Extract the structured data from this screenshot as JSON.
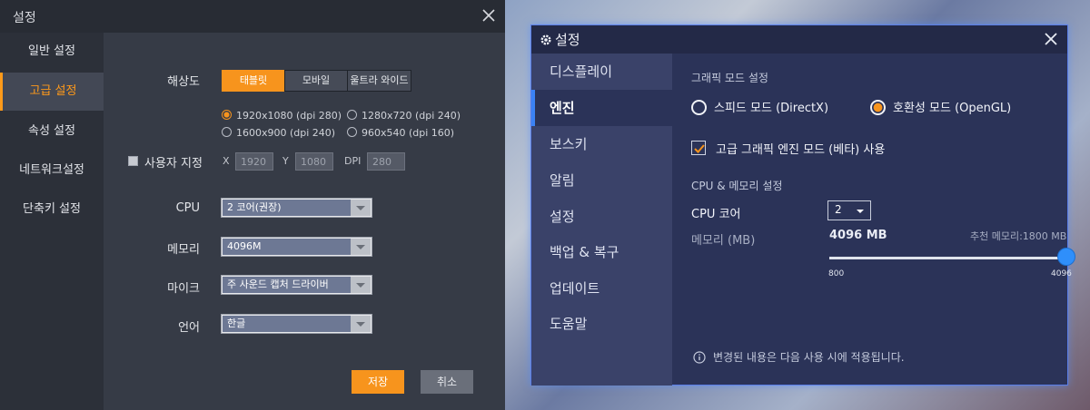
{
  "left": {
    "title": "설정",
    "sidebar": [
      "일반 설정",
      "고급 설정",
      "속성 설정",
      "네트워크설정",
      "단축키 설정"
    ],
    "active_index": 1,
    "resolution": {
      "label": "해상도",
      "tabs": [
        "태블릿",
        "모바일",
        "울트라 와이드"
      ],
      "active_tab": 0,
      "options": [
        "1920x1080 (dpi 280)",
        "1280x720 (dpi 240)",
        "1600x900 (dpi 240)",
        "960x540 (dpi 160)"
      ],
      "selected_option": 0
    },
    "custom": {
      "label": "사용자 지정",
      "x_label": "X",
      "x_value": "1920",
      "y_label": "Y",
      "y_value": "1080",
      "dpi_label": "DPI",
      "dpi_value": "280"
    },
    "cpu": {
      "label": "CPU",
      "value": "2 코어(권장)"
    },
    "memory": {
      "label": "메모리",
      "value": "4096M"
    },
    "mic": {
      "label": "마이크",
      "value": "주 사운드 캡처 드라이버"
    },
    "language": {
      "label": "언어",
      "value": "한글"
    },
    "save_label": "저장",
    "cancel_label": "취소",
    "accent_color": "#f7941d"
  },
  "right": {
    "title": "설정",
    "sidebar": [
      "디스플레이",
      "엔진",
      "보스키",
      "알림",
      "설정",
      "백업 & 복구",
      "업데이트",
      "도움말"
    ],
    "active_index": 1,
    "graphics": {
      "section": "그래픽 모드 설정",
      "option1": "스피드 모드 (DirectX)",
      "option2": "호환성 모드 (OpenGL)",
      "selected": 2,
      "advanced_engine": "고급 그래픽 엔진 모드 (베타) 사용",
      "advanced_checked": true
    },
    "cpu_mem": {
      "section": "CPU & 메모리 설정",
      "cpu_label": "CPU 코어",
      "cpu_value": "2",
      "mem_label": "메모리 (MB)",
      "mem_value": "4096 MB",
      "recommended": "추천 메모리:1800 MB",
      "slider_min": "800",
      "slider_max": "4096",
      "slider_fraction": 1.0
    },
    "notice": "변경된 내용은 다음 사용 시에 적용됩니다.",
    "accent_color": "#3b82f5"
  }
}
